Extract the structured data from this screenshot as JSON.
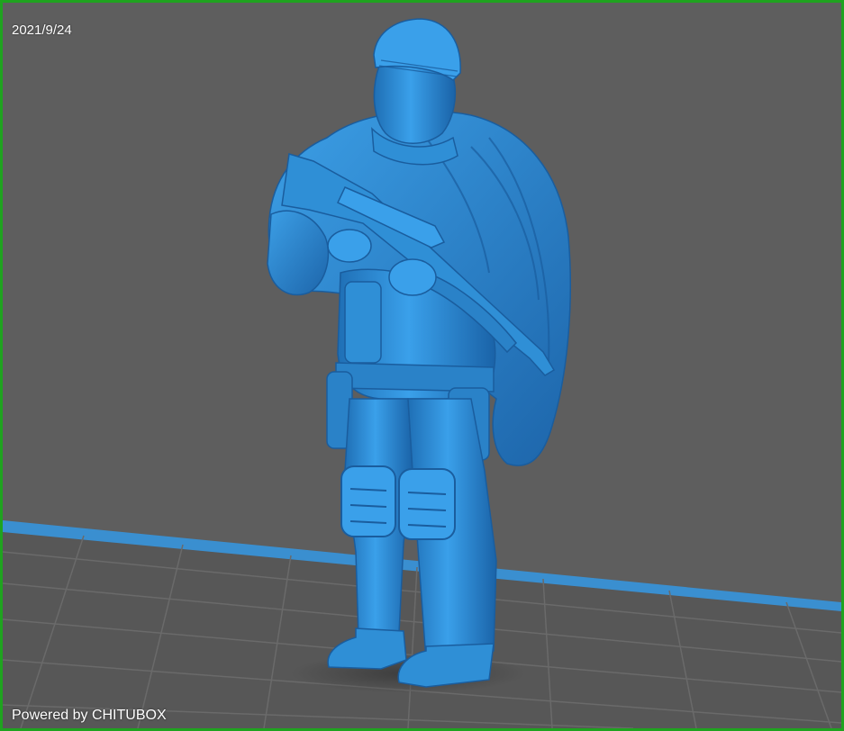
{
  "viewport": {
    "date_stamp": "2021/9/24",
    "watermark": "Powered by CHITUBOX",
    "frame_color": "#1fa31f",
    "background_color": "#5e5e5e",
    "model_color": "#2f8fd6",
    "build_plate_edge_color": "#3a8fd0"
  },
  "model": {
    "icon": "miniature-soldier-figure-icon"
  }
}
